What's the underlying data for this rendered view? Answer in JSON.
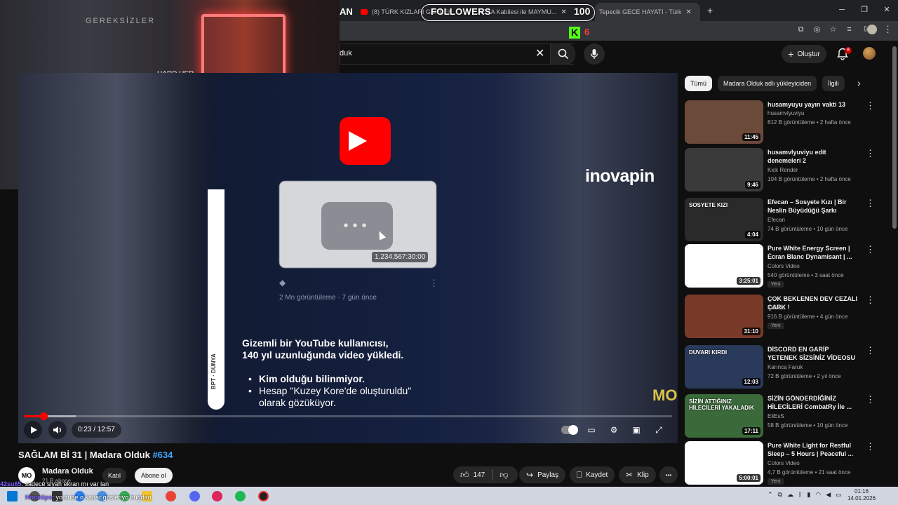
{
  "browser": {
    "tabs": [
      {
        "label": "(8) TÜRK KIZLARI GERÇEK..."
      },
      {
        "label": "...ADZA Kabilesi ile MAYMU..."
      },
      {
        "label": "Tepecik GECE HAYATI - Türk"
      }
    ],
    "new_tab": "+",
    "window_controls": [
      "─",
      "❐",
      "✕"
    ]
  },
  "overlay": {
    "left_text": "AN",
    "followers_label": "FOLLOWERS",
    "followers_count": "100",
    "kick_logo": "K",
    "kick_count": "6"
  },
  "masthead": {
    "search_value": "duk",
    "search_clear": "✕",
    "create_label": "Oluştur",
    "notif_count": "8"
  },
  "video": {
    "card_duration": "1.234.567:30:00",
    "card_meta": "2 Mn görüntüleme · 7 gün önce",
    "strip_text": "BPT · DÜNYA",
    "caption_line1": "Gizemli bir YouTube kullanıcısı,",
    "caption_line2": "140 yıl uzunluğunda video yükledi.",
    "bullets": [
      "Kim olduğu bilinmiyor.",
      "Hesap \"Kuzey Kore'de oluşturuldu\" olarak gözüküyor."
    ],
    "sponsor": "inovapin",
    "watermark": "MO",
    "progress": 0.03,
    "buffered": 0.08
  },
  "player": {
    "time": "0:23 / 12:57"
  },
  "info": {
    "title": "SAĞLAM Bİ 31 | Madara Olduk ",
    "title_tag": "#634",
    "channel_avatar": "MO",
    "channel_name": "Madara Olduk",
    "subscribers": "21 B abone",
    "join_label": "Katıl",
    "subscribe_label": "Abone ol",
    "likes": "147",
    "share_label": "Paylaş",
    "save_label": "Kaydet",
    "clip_label": "Klip",
    "more": "•••"
  },
  "sidebar": {
    "chips": [
      "Tümü",
      "Madara Olduk adlı yükleyiciden",
      "İlgili"
    ],
    "recommendations": [
      {
        "title": "husamyuyu yayın vakti 13",
        "channel": "husamvlyuviyu",
        "meta": "812 B görüntüleme • 2 hafta önce",
        "duration": "11:45",
        "badge": "",
        "thumb_color": "#6b4a3a"
      },
      {
        "title": "husamvlyuviyu edit denemeleri 2",
        "channel": "Kick Render",
        "meta": "104 B görüntüleme • 2 hafta önce",
        "duration": "9:46",
        "badge": "",
        "thumb_color": "#3a3a3a"
      },
      {
        "title": "Efecan – Sosyete Kızı | Bir Neslin Büyüdüğü Şarkı (Resmi...",
        "channel": "Efecan",
        "meta": "74 B görüntüleme • 10 gün önce",
        "duration": "4:04",
        "badge": "",
        "thumb_color": "#2a2a2a",
        "thumb_text": "SOSYETE KIZI"
      },
      {
        "title": "Pure White Energy Screen | Écran Blanc Dynamisant | ...",
        "channel": "Colors Video",
        "meta": "540 görüntüleme • 3 saat önce",
        "duration": "3:25:01",
        "badge": "Yeni",
        "thumb_color": "#ffffff"
      },
      {
        "title": "ÇOK BEKLENEN DEV CEZALI ÇARK !",
        "channel": "Kafalar",
        "meta": "916 B görüntüleme • 4 gün önce",
        "duration": "31:10",
        "badge": "Yeni",
        "thumb_color": "#7a3a2a"
      },
      {
        "title": "DİSCORD EN GARİP YETENEK SİZSİNİZ VİDEOSU",
        "channel": "Karınca Faruk",
        "meta": "72 B görüntüleme • 2 yıl önce",
        "duration": "12:03",
        "badge": "",
        "thumb_color": "#2a3a5a",
        "thumb_text": "DUVARI KIRDI"
      },
      {
        "title": "SİZİN GÖNDERDİĞİNİZ HİLECİLERİ CombatRy İle ...",
        "channel": "EliEsS",
        "meta": "58 B görüntüleme • 10 gün önce",
        "duration": "17:11",
        "badge": "",
        "thumb_color": "#3a6a3a",
        "thumb_text": "SİZİN ATTIĞINIZ HİLECİLERİ YAKALADIK"
      },
      {
        "title": "Pure White Light for Restful Sleep – 5 Hours | Peaceful ...",
        "channel": "Colors Video",
        "meta": "4,7 B görüntüleme • 21 saat önce",
        "duration": "5:00:01",
        "badge": "Yeni",
        "thumb_color": "#ffffff"
      }
    ]
  },
  "webcam": {
    "wall_text": "GEREKSİZLER",
    "sign_text": "HARD HER"
  },
  "chat": {
    "line1_user": "42su65",
    "line1_text": ": sadece siyah ekran mı var lan",
    "line2_user": "Hocetipo",
    "line2_text": ": youtube o kadar gösteriyo bugdan"
  },
  "taskbar": {
    "time": "01:16",
    "date": "14.01.2026"
  }
}
